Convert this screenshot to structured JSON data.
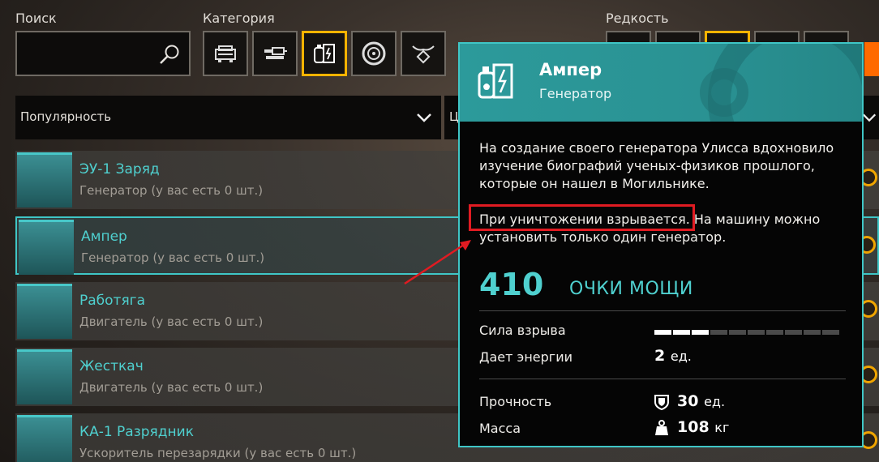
{
  "filters": {
    "search_label": "Поиск",
    "search_value": "",
    "category_label": "Категория",
    "rarity_label": "Редкость",
    "categories": [
      "cabin-icon",
      "weapon-icon",
      "generator-icon",
      "wheel-icon",
      "decor-icon"
    ],
    "active_category": "generator-icon"
  },
  "sort": {
    "label": "Популярность",
    "label2": "Ц"
  },
  "list": [
    {
      "name": "ЭУ-1 Заряд",
      "sub": "Генератор (у вас есть 0 шт.)"
    },
    {
      "name": "Ампер",
      "sub": "Генератор (у вас есть 0 шт.)"
    },
    {
      "name": "Работяга",
      "sub": "Двигатель (у вас есть 0 шт.)"
    },
    {
      "name": "Жесткач",
      "sub": "Двигатель (у вас есть 0 шт.)"
    },
    {
      "name": "КА-1 Разрядник",
      "sub": "Ускоритель перезарядки (у вас есть 0 шт.)"
    }
  ],
  "tooltip": {
    "title": "Ампер",
    "type": "Генератор",
    "description": "На создание своего генератора Улисса вдохновило изучение биографий ученых-физиков прошлого, которые он нашел в Могильнике.",
    "highlight": "При уничтожении взрывается.",
    "description2_rest": " На машину можно установить только один генератор.",
    "points": "410",
    "points_label": "ОЧКИ МОЩИ",
    "stats": {
      "blast_label": "Сила взрыва",
      "blast_level": 3,
      "blast_max": 10,
      "energy_label": "Дает энергии",
      "energy_value": "2",
      "energy_unit": "ед.",
      "durability_label": "Прочность",
      "durability_value": "30",
      "durability_unit": "ед.",
      "mass_label": "Масса",
      "mass_value": "108",
      "mass_unit": "кг"
    }
  },
  "colors": {
    "accent": "#3fc6c6",
    "highlight": "#e11b22",
    "active_border": "#ffb300"
  }
}
